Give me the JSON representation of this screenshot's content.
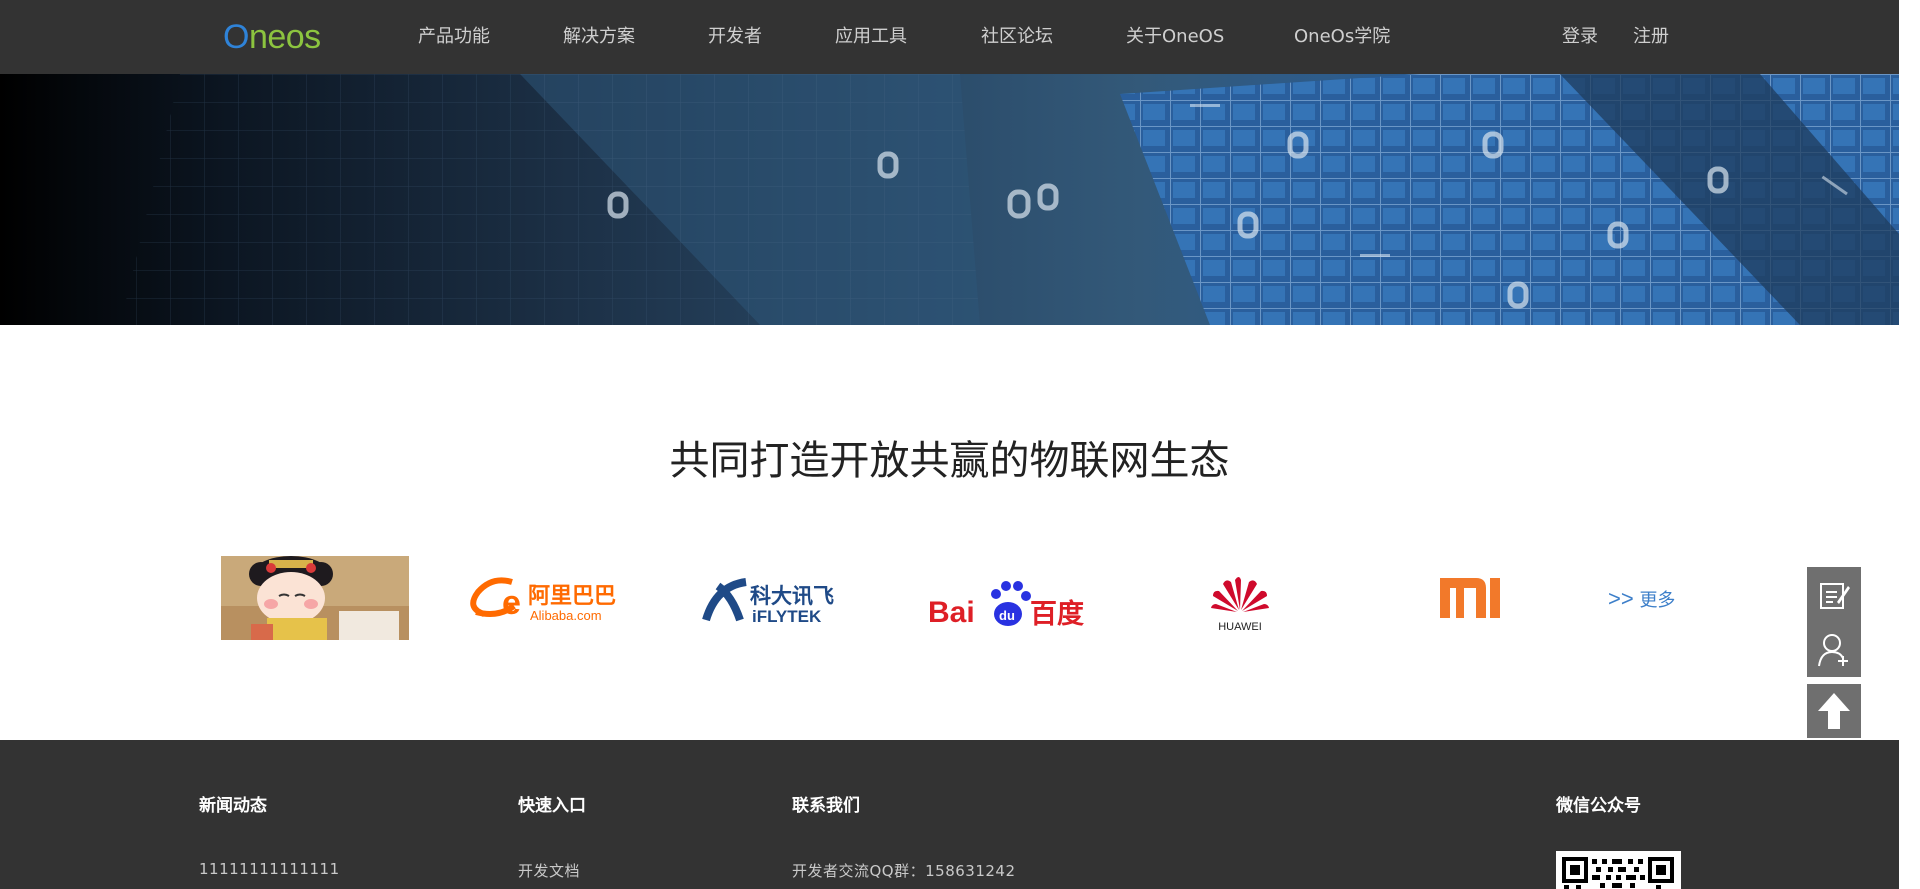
{
  "nav": {
    "logo_first": "O",
    "logo_rest": "neos",
    "items": [
      {
        "label": "产品功能"
      },
      {
        "label": "解决方案"
      },
      {
        "label": "开发者"
      },
      {
        "label": "应用工具"
      },
      {
        "label": "社区论坛"
      },
      {
        "label": "关于OneOS"
      },
      {
        "label": "OneOs学院"
      }
    ],
    "login": "登录",
    "register": "注册"
  },
  "ecosystem": {
    "title": "共同打造开放共赢的物联网生态",
    "partners": [
      {
        "name": "avatar"
      },
      {
        "name": "alibaba",
        "text_cn": "阿里巴巴",
        "text_en": "Alibaba.com",
        "color": "#ff6a00"
      },
      {
        "name": "iflytek",
        "text_cn": "科大讯飞",
        "text_en": "iFLYTEK",
        "color": "#1f4a87"
      },
      {
        "name": "baidu",
        "text_a": "Bai",
        "text_b": "du",
        "text_cn": "百度",
        "color_red": "#de1f26",
        "color_blue": "#2932e1"
      },
      {
        "name": "huawei",
        "text_en": "HUAWEI",
        "color": "#cf0a2c"
      },
      {
        "name": "xiaomi",
        "color": "#f2792a"
      }
    ],
    "more_arrows": ">>",
    "more_label": "更多"
  },
  "side_buttons": {
    "icons": [
      "edit-icon",
      "add-user-icon",
      "back-to-top-icon"
    ],
    "color": "#6f6f6f"
  },
  "footer": {
    "news": {
      "title": "新闻动态",
      "item": "11111111111111"
    },
    "quick": {
      "title": "快速入口",
      "item": "开发文档"
    },
    "contact": {
      "title": "联系我们",
      "item": "开发者交流QQ群：158631242"
    },
    "wechat": {
      "title": "微信公众号"
    }
  },
  "colors": {
    "nav_bg": "#333333",
    "footer_bg": "#333333",
    "logo_blue": "#2f83d8",
    "logo_green": "#8cc43f",
    "link_blue": "#3d7fc9"
  }
}
